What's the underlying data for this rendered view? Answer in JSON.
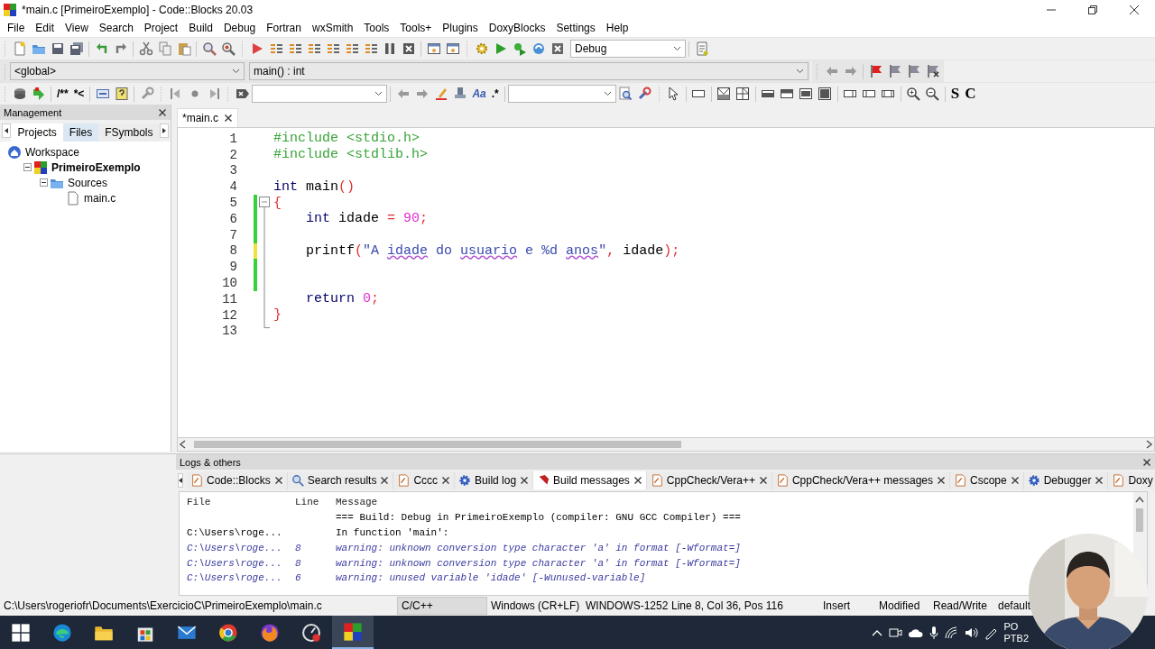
{
  "window": {
    "title": "*main.c [PrimeiroExemplo] - Code::Blocks 20.03"
  },
  "menu": [
    "File",
    "Edit",
    "View",
    "Search",
    "Project",
    "Build",
    "Debug",
    "Fortran",
    "wxSmith",
    "Tools",
    "Tools+",
    "Plugins",
    "DoxyBlocks",
    "Settings",
    "Help"
  ],
  "toolbar": {
    "build_target": "Debug"
  },
  "code_toolbar": {
    "scope": "<global>",
    "function": "main() : int"
  },
  "doxy_toolbar": {
    "buttons": [
      "/**",
      "*<"
    ],
    "match_case": "Aa",
    "regex": ".*",
    "styles": [
      "S",
      "C"
    ]
  },
  "management": {
    "title": "Management",
    "tabs": [
      {
        "label": "Projects",
        "selected": true
      },
      {
        "label": "Files",
        "selected": false
      },
      {
        "label": "FSymbols",
        "selected": false
      }
    ],
    "tree": [
      {
        "label": "Workspace",
        "kind": "workspace",
        "active": false,
        "children": [
          {
            "label": "PrimeiroExemplo",
            "kind": "project",
            "active": true,
            "children": [
              {
                "label": "Sources",
                "kind": "folder",
                "active": false,
                "children": [
                  {
                    "label": "main.c",
                    "kind": "file",
                    "active": false
                  }
                ]
              }
            ]
          }
        ]
      }
    ]
  },
  "editor": {
    "tabs": [
      {
        "label": "*main.c",
        "selected": true
      }
    ],
    "lines": [
      {
        "number": "1",
        "tokens": [
          {
            "kind": "pre",
            "text": "#include <stdio.h>"
          }
        ]
      },
      {
        "number": "2",
        "tokens": [
          {
            "kind": "pre",
            "text": "#include <stdlib.h>"
          }
        ]
      },
      {
        "number": "3"
      },
      {
        "number": "4",
        "tokens": [
          {
            "kind": "kw",
            "text": "int"
          },
          {
            "kind": "plain",
            "text": " main"
          },
          {
            "kind": "op",
            "text": "()"
          }
        ]
      },
      {
        "number": "5",
        "color": "#3ad03a",
        "fold": {
          "expanded": true
        },
        "tokens": [
          {
            "kind": "op",
            "text": "{"
          }
        ]
      },
      {
        "number": "6",
        "color": "#3ad03a",
        "indent": true,
        "tokens": [
          {
            "kind": "kw",
            "text": "int"
          },
          {
            "kind": "plain",
            "text": " idade "
          },
          {
            "kind": "op",
            "text": "="
          },
          {
            "kind": "num",
            "text": " 90"
          },
          {
            "kind": "op",
            "text": ";"
          }
        ]
      },
      {
        "number": "7",
        "color": "#3ad03a"
      },
      {
        "number": "8",
        "color": "#f0e040",
        "indent": true,
        "tokens": [
          {
            "kind": "plain",
            "text": "printf"
          },
          {
            "kind": "op",
            "text": "("
          },
          {
            "kind": "str",
            "text": "\"A "
          },
          {
            "kind": "misspelled",
            "text": "idade"
          },
          {
            "kind": "str",
            "text": " do "
          },
          {
            "kind": "misspelled",
            "text": "usuario"
          },
          {
            "kind": "str",
            "text": " e %d "
          },
          {
            "kind": "misspelled",
            "text": "anos"
          },
          {
            "kind": "str",
            "text": "\""
          },
          {
            "kind": "op",
            "text": ","
          },
          {
            "kind": "plain",
            "text": " idade"
          },
          {
            "kind": "op",
            "text": ");"
          }
        ]
      },
      {
        "number": "9",
        "color": "#3ad03a"
      },
      {
        "number": "10",
        "color": "#3ad03a"
      },
      {
        "number": "11",
        "indent": true,
        "tokens": [
          {
            "kind": "kw",
            "text": "return"
          },
          {
            "kind": "num",
            "text": " 0"
          },
          {
            "kind": "op",
            "text": ";"
          }
        ]
      },
      {
        "number": "12",
        "tokens": [
          {
            "kind": "op",
            "text": "}"
          }
        ]
      },
      {
        "number": "13"
      }
    ]
  },
  "logs": {
    "title": "Logs & others",
    "tabs": [
      {
        "label": "Code::Blocks",
        "kind": "doc",
        "selected": false
      },
      {
        "label": "Search results",
        "kind": "search",
        "selected": false
      },
      {
        "label": "Cccc",
        "kind": "doc",
        "selected": false
      },
      {
        "label": "Build log",
        "kind": "gear",
        "selected": false
      },
      {
        "label": "Build messages",
        "kind": "pin",
        "selected": true
      },
      {
        "label": "CppCheck/Vera++",
        "kind": "doc",
        "selected": false
      },
      {
        "label": "CppCheck/Vera++ messages",
        "kind": "doc",
        "selected": false
      },
      {
        "label": "Cscope",
        "kind": "doc",
        "selected": false
      },
      {
        "label": "Debugger",
        "kind": "gear",
        "selected": false
      },
      {
        "label": "Doxy",
        "kind": "doc",
        "selected": false
      }
    ],
    "columns": [
      "File",
      "Line",
      "Message"
    ],
    "rows": [
      {
        "kind": "info",
        "message": "=== Build: Debug in PrimeiroExemplo (compiler: GNU GCC Compiler) ==="
      },
      {
        "kind": "info",
        "file": "C:\\Users\\roge...",
        "message": "In function 'main':"
      },
      {
        "kind": "warning",
        "file": "C:\\Users\\roge...",
        "line": "8",
        "message": "warning: unknown conversion type character 'a' in format [-Wformat=]"
      },
      {
        "kind": "warning",
        "file": "C:\\Users\\roge...",
        "line": "8",
        "message": "warning: unknown conversion type character 'a' in format [-Wformat=]"
      },
      {
        "kind": "warning",
        "file": "C:\\Users\\roge...",
        "line": "6",
        "message": "warning: unused variable 'idade' [-Wunused-variable]"
      }
    ]
  },
  "status_bar": [
    "C:\\Users\\rogeriofr\\Documents\\ExercicioC\\PrimeiroExemplo\\main.c",
    "C/C++",
    "Windows (CR+LF)",
    "WINDOWS-1252",
    "Line 8, Col 36, Pos 116",
    "Insert",
    "Modified",
    "Read/Write",
    "default"
  ],
  "taskbar": {
    "language": [
      "PO",
      "PTB2"
    ]
  },
  "webcam": {
    "kind": "picture"
  }
}
